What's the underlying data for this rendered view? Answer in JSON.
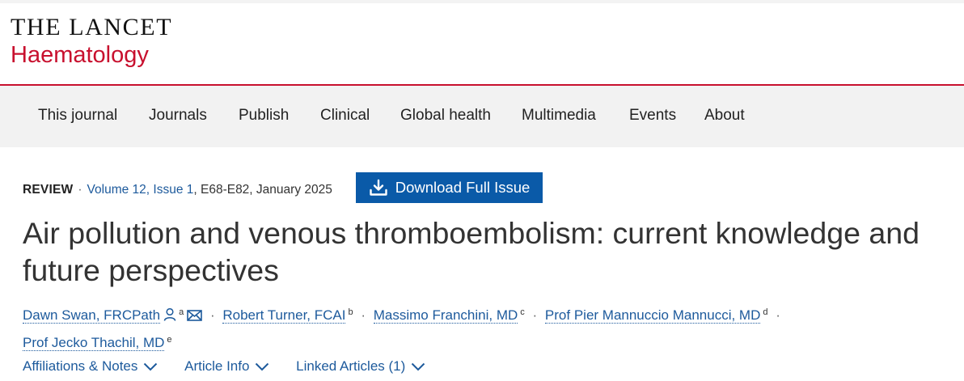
{
  "journal": {
    "brand": "THE LANCET",
    "name": "Haematology"
  },
  "nav": {
    "items": [
      "This journal",
      "Journals",
      "Publish",
      "Clinical",
      "Global health",
      "Multimedia",
      "Events",
      "About"
    ]
  },
  "article": {
    "type": "REVIEW",
    "separator": "·",
    "volume_issue": "Volume 12, Issue 1",
    "pages_date": ", E68-E82, January 2025",
    "download_label": "Download Full Issue",
    "title": "Air pollution and venous thromboembolism: current knowledge and future perspectives",
    "authors": [
      {
        "name": "Dawn Swan, FRCPath",
        "sup": "a"
      },
      {
        "name": "Robert Turner, FCAI",
        "sup": "b"
      },
      {
        "name": "Massimo Franchini, MD",
        "sup": "c"
      },
      {
        "name": "Prof Pier Mannuccio Mannucci, MD",
        "sup": "d"
      },
      {
        "name": "Prof Jecko Thachil, MD",
        "sup": "e"
      }
    ],
    "links": [
      "Affiliations & Notes",
      "Article Info",
      "Linked Articles (1)"
    ]
  },
  "icons": {
    "download": "download-icon",
    "person": "person-icon",
    "email": "email-icon",
    "chevron": "chevron-down-icon"
  },
  "colors": {
    "brand_red": "#c8102e",
    "link_blue": "#1d5a9c",
    "button_blue": "#0a5aa8",
    "nav_bg": "#f2f2f2"
  }
}
